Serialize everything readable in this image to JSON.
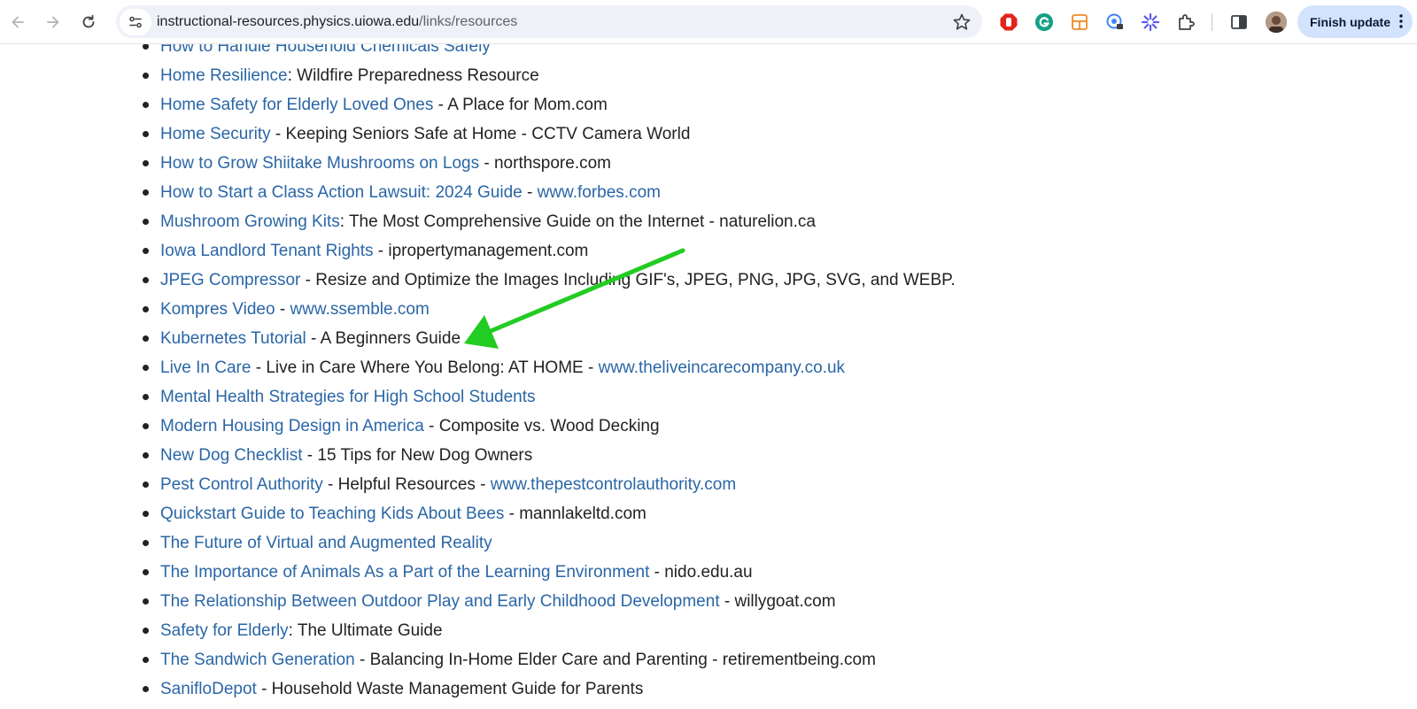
{
  "browser": {
    "url_host": "instructional-resources.physics.uiowa.edu",
    "url_path": "/links/resources",
    "finish_update_label": "Finish update"
  },
  "colors": {
    "link": "#2a66a6",
    "text": "#222222",
    "arrow": "#22cc22",
    "finish_button_bg": "#d3e3fd"
  },
  "resources": [
    {
      "parts": [
        {
          "t": "How to Handle Household Chemicals Safely",
          "link": true
        }
      ]
    },
    {
      "parts": [
        {
          "t": "Home Resilience",
          "link": true
        },
        {
          "t": ": Wildfire Preparedness Resource",
          "link": false
        }
      ]
    },
    {
      "parts": [
        {
          "t": "Home Safety for Elderly Loved Ones",
          "link": true
        },
        {
          "t": " - A Place for Mom.com",
          "link": false
        }
      ]
    },
    {
      "parts": [
        {
          "t": "Home Security",
          "link": true
        },
        {
          "t": " - Keeping Seniors Safe at Home - CCTV Camera World",
          "link": false
        }
      ]
    },
    {
      "parts": [
        {
          "t": "How to Grow Shiitake Mushrooms on Logs",
          "link": true
        },
        {
          "t": " - northspore.com",
          "link": false
        }
      ]
    },
    {
      "parts": [
        {
          "t": "How to Start a Class Action Lawsuit: 2024 Guide",
          "link": true
        },
        {
          "t": " - ",
          "link": false
        },
        {
          "t": "www.forbes.com",
          "link": true
        }
      ]
    },
    {
      "parts": [
        {
          "t": "Mushroom Growing Kits",
          "link": true
        },
        {
          "t": ": The Most Comprehensive Guide on the Internet - naturelion.ca",
          "link": false
        }
      ]
    },
    {
      "parts": [
        {
          "t": "Iowa Landlord Tenant Rights",
          "link": true
        },
        {
          "t": " - ipropertymanagement.com",
          "link": false
        }
      ]
    },
    {
      "parts": [
        {
          "t": "JPEG Compressor",
          "link": true
        },
        {
          "t": " - Resize and Optimize the Images Including GIF's, JPEG, PNG, JPG, SVG, and WEBP.",
          "link": false
        }
      ]
    },
    {
      "parts": [
        {
          "t": "Kompres Video",
          "link": true
        },
        {
          "t": " - ",
          "link": false
        },
        {
          "t": "www.ssemble.com",
          "link": true
        }
      ]
    },
    {
      "parts": [
        {
          "t": "Kubernetes Tutorial",
          "link": true
        },
        {
          "t": " - A Beginners Guide",
          "link": false
        }
      ]
    },
    {
      "parts": [
        {
          "t": "Live In Care",
          "link": true
        },
        {
          "t": " - Live in Care Where You Belong:  AT HOME - ",
          "link": false
        },
        {
          "t": "www.theliveincarecompany.co.uk",
          "link": true
        }
      ]
    },
    {
      "parts": [
        {
          "t": "Mental Health Strategies for High School Students",
          "link": true
        }
      ]
    },
    {
      "parts": [
        {
          "t": "Modern Housing Design in America",
          "link": true
        },
        {
          "t": " - Composite vs. Wood Decking",
          "link": false
        }
      ]
    },
    {
      "parts": [
        {
          "t": "New Dog Checklist",
          "link": true
        },
        {
          "t": " - 15 Tips for New Dog Owners",
          "link": false
        }
      ]
    },
    {
      "parts": [
        {
          "t": "Pest Control Authority",
          "link": true
        },
        {
          "t": " - Helpful Resources - ",
          "link": false
        },
        {
          "t": "www.thepestcontrolauthority.com",
          "link": true
        }
      ]
    },
    {
      "parts": [
        {
          "t": "Quickstart Guide to Teaching Kids About Bees",
          "link": true
        },
        {
          "t": " - mannlakeltd.com",
          "link": false
        }
      ]
    },
    {
      "parts": [
        {
          "t": "The Future of Virtual and Augmented Reality",
          "link": true
        }
      ]
    },
    {
      "parts": [
        {
          "t": "The Importance of Animals As a Part of the Learning Environment",
          "link": true
        },
        {
          "t": " - nido.edu.au",
          "link": false
        }
      ]
    },
    {
      "parts": [
        {
          "t": "The Relationship Between Outdoor Play and Early Childhood Development",
          "link": true
        },
        {
          "t": " - willygoat.com",
          "link": false
        }
      ]
    },
    {
      "parts": [
        {
          "t": "Safety for Elderly",
          "link": true
        },
        {
          "t": ": The Ultimate Guide",
          "link": false
        }
      ]
    },
    {
      "parts": [
        {
          "t": "The Sandwich Generation",
          "link": true
        },
        {
          "t": " - Balancing In-Home Elder Care and Parenting - retirementbeing.com",
          "link": false
        }
      ]
    },
    {
      "parts": [
        {
          "t": "SanifloDepot",
          "link": true
        },
        {
          "t": " - Household Waste Management Guide for Parents",
          "link": false
        }
      ]
    }
  ]
}
